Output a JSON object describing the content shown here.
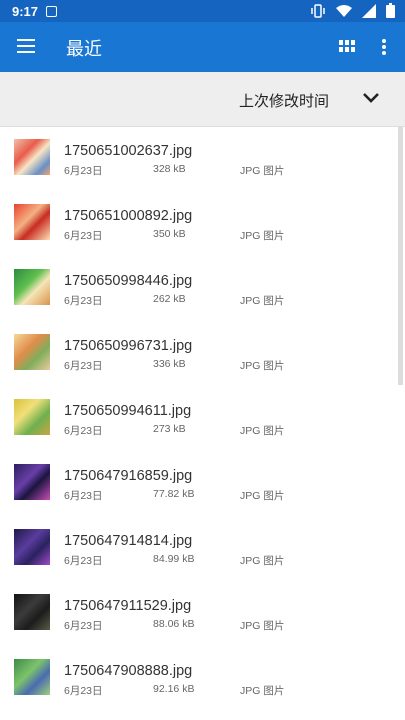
{
  "status_bar": {
    "time": "9:17"
  },
  "app_bar": {
    "title": "最近"
  },
  "sort_bar": {
    "label": "上次修改时间"
  },
  "files": [
    {
      "name": "1750651002637.jpg",
      "date": "6月23日",
      "size": "328 kB",
      "type": "JPG 图片"
    },
    {
      "name": "1750651000892.jpg",
      "date": "6月23日",
      "size": "350 kB",
      "type": "JPG 图片"
    },
    {
      "name": "1750650998446.jpg",
      "date": "6月23日",
      "size": "262 kB",
      "type": "JPG 图片"
    },
    {
      "name": "1750650996731.jpg",
      "date": "6月23日",
      "size": "336 kB",
      "type": "JPG 图片"
    },
    {
      "name": "1750650994611.jpg",
      "date": "6月23日",
      "size": "273 kB",
      "type": "JPG 图片"
    },
    {
      "name": "1750647916859.jpg",
      "date": "6月23日",
      "size": "77.82 kB",
      "type": "JPG 图片"
    },
    {
      "name": "1750647914814.jpg",
      "date": "6月23日",
      "size": "84.99 kB",
      "type": "JPG 图片"
    },
    {
      "name": "1750647911529.jpg",
      "date": "6月23日",
      "size": "88.06 kB",
      "type": "JPG 图片"
    },
    {
      "name": "1750647908888.jpg",
      "date": "6月23日",
      "size": "92.16 kB",
      "type": "JPG 图片"
    }
  ],
  "colors": {
    "status_bar": "#1565c0",
    "app_bar": "#1976d2",
    "sort_bar": "#eeeeee"
  }
}
